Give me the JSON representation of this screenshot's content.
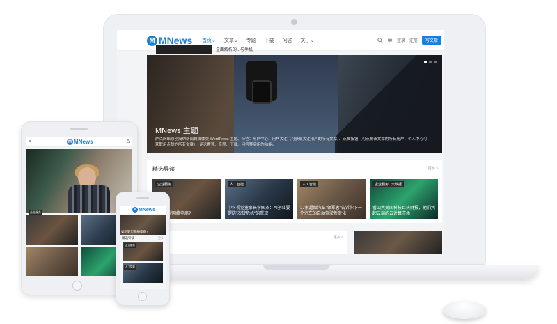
{
  "site": {
    "logo_letter": "M",
    "logo_text": "MNews",
    "brand_color": "#1e7fd9"
  },
  "header": {
    "nav": [
      "首页",
      "文章",
      "专题",
      "下载",
      "问答",
      "关于"
    ],
    "nav_carets": [
      "⌄",
      "⌄",
      "",
      "",
      "",
      "⌄"
    ],
    "search_icon": "search-icon",
    "chat_icon": "chat-icon",
    "login": "登录",
    "register": "注册",
    "post_button": "写文章"
  },
  "hero": {
    "title": "MNews 主题",
    "description": "萨克网络原创简约新闻自媒体类 WordPress 主题。特色：用户中心、用户关注（可获取关注用户的所有文章）、点赞按钮（可点赞该文章的所有用户，个人中心可获取用点赞的所有文章）、评论置顶、专题、下载、问答等实用的功能。"
  },
  "featured": {
    "title": "精选导读",
    "more": "更多 >",
    "cards": [
      {
        "tag": "企业服务",
        "tag2": "",
        "caption": "如何转型网络电商?"
      },
      {
        "tag": "人工智能",
        "tag2": "",
        "caption": "中科视觉董事长李国杰：AI创业要提防\"次贷危机\"的重现"
      },
      {
        "tag": "人工智能",
        "tag2": "",
        "caption": "17家超级汽车\"领军者\"告诉你下一个汽车的自动驾驶新变化"
      },
      {
        "tag": "企业服务",
        "tag2": "大数据",
        "caption": "看四大美国科技巨头财报，他们凭起云端的云计算市场"
      }
    ]
  },
  "lower": {
    "more": "更多 >",
    "text": "全面解析的...与手机"
  },
  "tablet": {
    "logo_letter": "M",
    "logo_text": "MNews",
    "menu": "≡",
    "user": "♙",
    "hero_tag": "企业服务"
  },
  "phone": {
    "logo_letter": "M",
    "logo_text": "MNews",
    "hero_caption": "如何转型网络电商?",
    "section_title": "精选导读",
    "section_more": "更多",
    "card_tag_1": "企业服务",
    "card_tag_2": "人工智能"
  }
}
